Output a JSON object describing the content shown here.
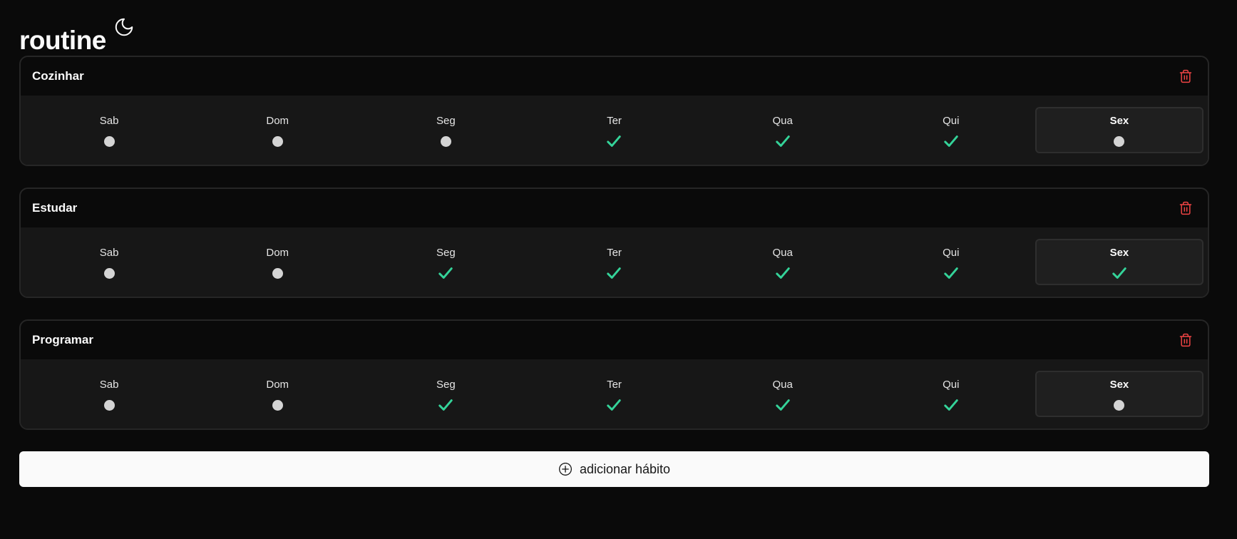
{
  "app": {
    "title": "routine",
    "theme_toggle_icon": "moon-icon"
  },
  "colors": {
    "background": "#0a0a0a",
    "card_body": "#171717",
    "done": "#34d399",
    "delete": "#ef4444",
    "button_bg": "#fafafa"
  },
  "habits": [
    {
      "name": "Cozinhar",
      "delete_icon": "trash-icon",
      "days": [
        {
          "label": "Sab",
          "done": false
        },
        {
          "label": "Dom",
          "done": false
        },
        {
          "label": "Seg",
          "done": false
        },
        {
          "label": "Ter",
          "done": true
        },
        {
          "label": "Qua",
          "done": true
        },
        {
          "label": "Qui",
          "done": true
        },
        {
          "label": "Sex",
          "done": false,
          "today": true
        }
      ]
    },
    {
      "name": "Estudar",
      "delete_icon": "trash-icon",
      "days": [
        {
          "label": "Sab",
          "done": false
        },
        {
          "label": "Dom",
          "done": false
        },
        {
          "label": "Seg",
          "done": true
        },
        {
          "label": "Ter",
          "done": true
        },
        {
          "label": "Qua",
          "done": true
        },
        {
          "label": "Qui",
          "done": true
        },
        {
          "label": "Sex",
          "done": true,
          "today": true
        }
      ]
    },
    {
      "name": "Programar",
      "delete_icon": "trash-icon",
      "days": [
        {
          "label": "Sab",
          "done": false
        },
        {
          "label": "Dom",
          "done": false
        },
        {
          "label": "Seg",
          "done": true
        },
        {
          "label": "Ter",
          "done": true
        },
        {
          "label": "Qua",
          "done": true
        },
        {
          "label": "Qui",
          "done": true
        },
        {
          "label": "Sex",
          "done": false,
          "today": true
        }
      ]
    }
  ],
  "add_habit": {
    "label": "adicionar hábito",
    "icon": "plus-circle-icon"
  }
}
